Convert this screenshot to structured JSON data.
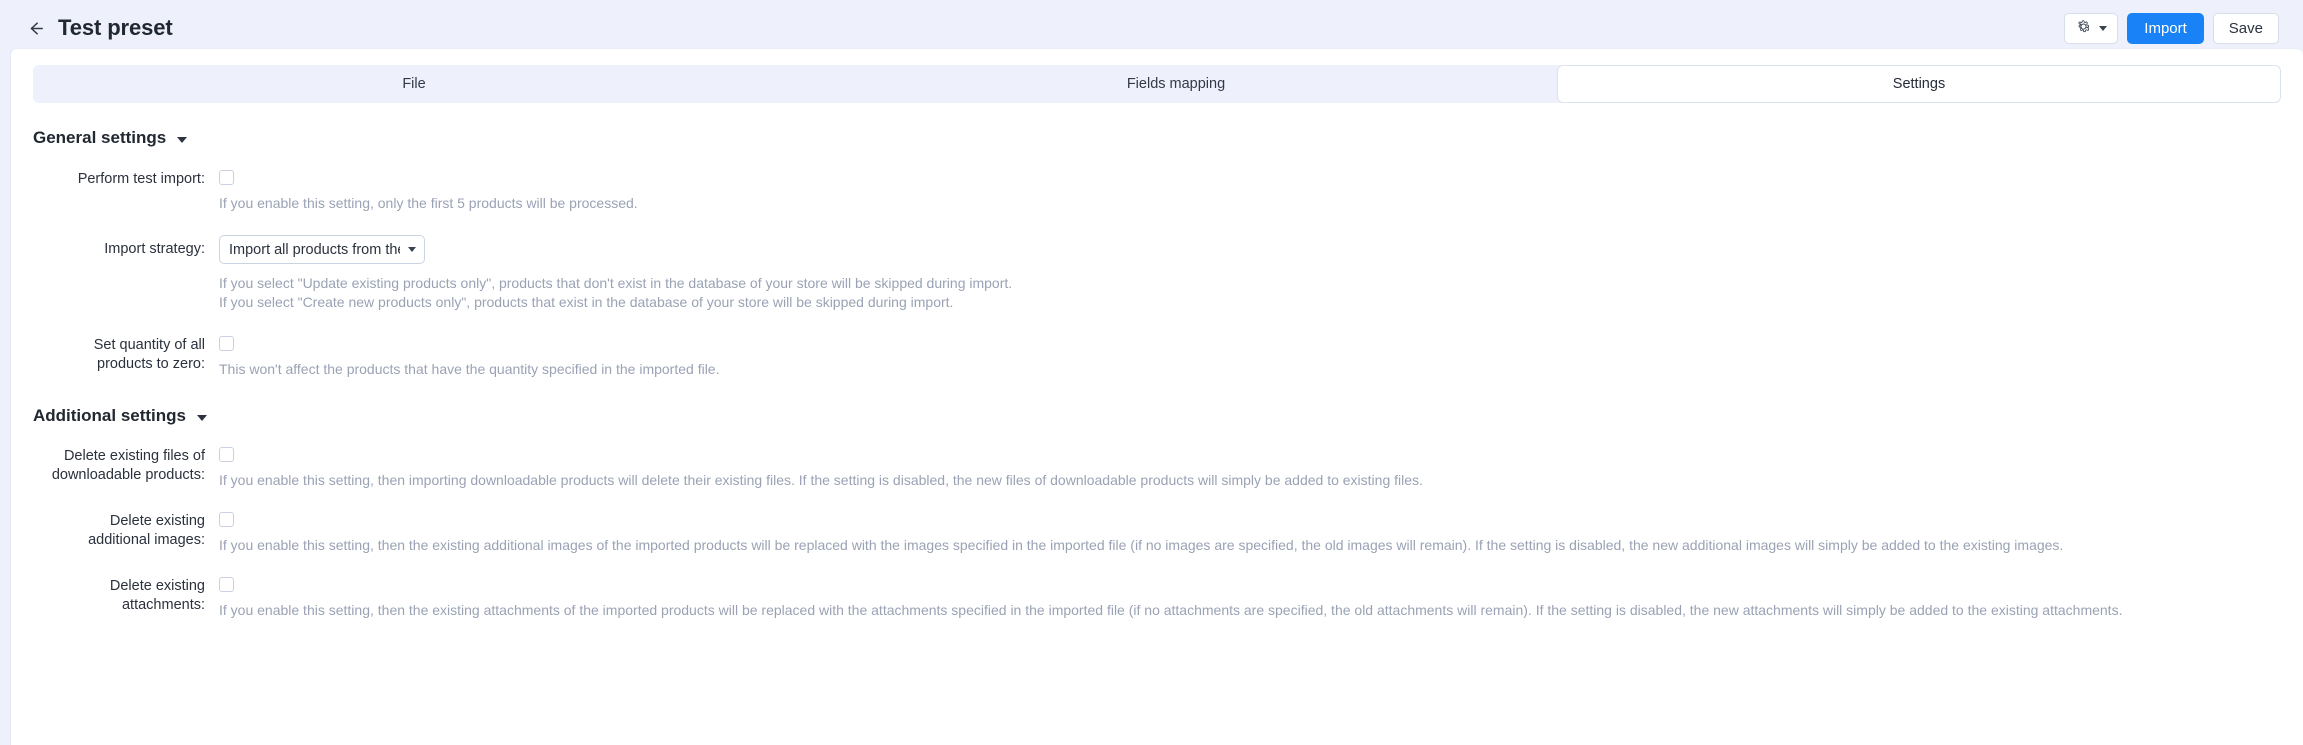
{
  "header": {
    "back_icon": "arrow-left-icon",
    "title": "Test preset",
    "gear_icon": "gear-icon",
    "import_label": "Import",
    "save_label": "Save",
    "accent_color": "#1a82f7",
    "background_color": "#eef1fb"
  },
  "tabs": [
    {
      "label": "File",
      "active": false
    },
    {
      "label": "Fields mapping",
      "active": false
    },
    {
      "label": "Settings",
      "active": true
    }
  ],
  "sections": {
    "general": {
      "title": "General settings",
      "expanded": true,
      "fields": {
        "perform_test_import": {
          "label": "Perform test import:",
          "checked": false,
          "help": "If you enable this setting, only the first 5 products will be processed."
        },
        "import_strategy": {
          "label": "Import strategy:",
          "value": "Import all products from the l",
          "options": [
            "Import all products from the file",
            "Update existing products only",
            "Create new products only"
          ],
          "help_line_1": "If you select \"Update existing products only\", products that don't exist in the database of your store will be skipped during import.",
          "help_line_2": "If you select \"Create new products only\", products that exist in the database of your store will be skipped during import."
        },
        "set_quantity_zero": {
          "label": "Set quantity of all\nproducts to zero:",
          "checked": false,
          "help": "This won't affect the products that have the quantity specified in the imported file."
        }
      }
    },
    "additional": {
      "title": "Additional settings",
      "expanded": true,
      "fields": {
        "delete_existing_files": {
          "label": "Delete existing files of\ndownloadable products:",
          "checked": false,
          "help": "If you enable this setting, then importing downloadable products will delete their existing files. If the setting is disabled, the new files of downloadable products will simply be added to existing files."
        },
        "delete_additional_images": {
          "label": "Delete existing\nadditional images:",
          "checked": false,
          "help": "If you enable this setting, then the existing additional images of the imported products will be replaced with the images specified in the imported file (if no images are specified, the old images will remain). If the setting is disabled, the new additional images will simply be added to the existing images."
        },
        "delete_attachments": {
          "label": "Delete existing\nattachments:",
          "checked": false,
          "help": "If you enable this setting, then the existing attachments of the imported products will be replaced with the attachments specified in the imported file (if no attachments are specified, the old attachments will remain). If the setting is disabled, the new attachments will simply be added to the existing attachments."
        }
      }
    }
  }
}
